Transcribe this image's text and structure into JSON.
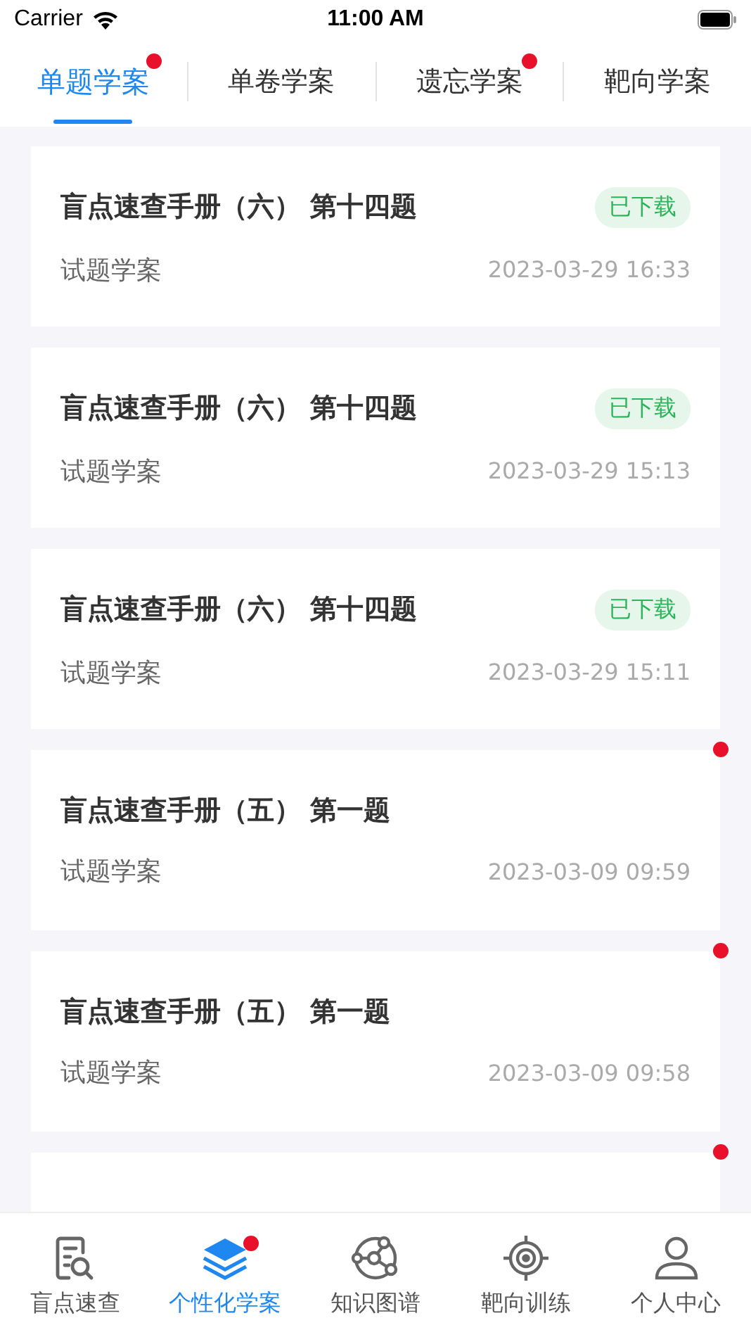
{
  "status_bar": {
    "carrier": "Carrier",
    "time": "11:00 AM"
  },
  "tabs": [
    {
      "label": "单题学案",
      "selected": true,
      "unread": true
    },
    {
      "label": "单卷学案",
      "selected": false,
      "unread": false
    },
    {
      "label": "遗忘学案",
      "selected": false,
      "unread": true
    },
    {
      "label": "靶向学案",
      "selected": false,
      "unread": false
    }
  ],
  "items": [
    {
      "title": "盲点速查手册（六） 第十四题",
      "tag": "已下载",
      "subtitle": "试题学案",
      "date": "2023-03-29 16:33",
      "unread": false
    },
    {
      "title": "盲点速查手册（六） 第十四题",
      "tag": "已下载",
      "subtitle": "试题学案",
      "date": "2023-03-29 15:13",
      "unread": false
    },
    {
      "title": "盲点速查手册（六） 第十四题",
      "tag": "已下载",
      "subtitle": "试题学案",
      "date": "2023-03-29 15:11",
      "unread": false
    },
    {
      "title": "盲点速查手册（五） 第一题",
      "subtitle": "试题学案",
      "date": "2023-03-09 09:59",
      "unread": true
    },
    {
      "title": "盲点速查手册（五） 第一题",
      "subtitle": "试题学案",
      "date": "2023-03-09 09:58",
      "unread": true
    },
    {
      "unread": true
    }
  ],
  "bottom_nav": [
    {
      "kind": "search-doc",
      "label": "盲点速查",
      "selected": false,
      "unread": false
    },
    {
      "kind": "layers",
      "label": "个性化学案",
      "selected": true,
      "unread": true
    },
    {
      "kind": "graph",
      "label": "知识图谱",
      "selected": false,
      "unread": false
    },
    {
      "kind": "target",
      "label": "靶向训练",
      "selected": false,
      "unread": false
    },
    {
      "kind": "person",
      "label": "个人中心",
      "selected": false,
      "unread": false
    }
  ]
}
